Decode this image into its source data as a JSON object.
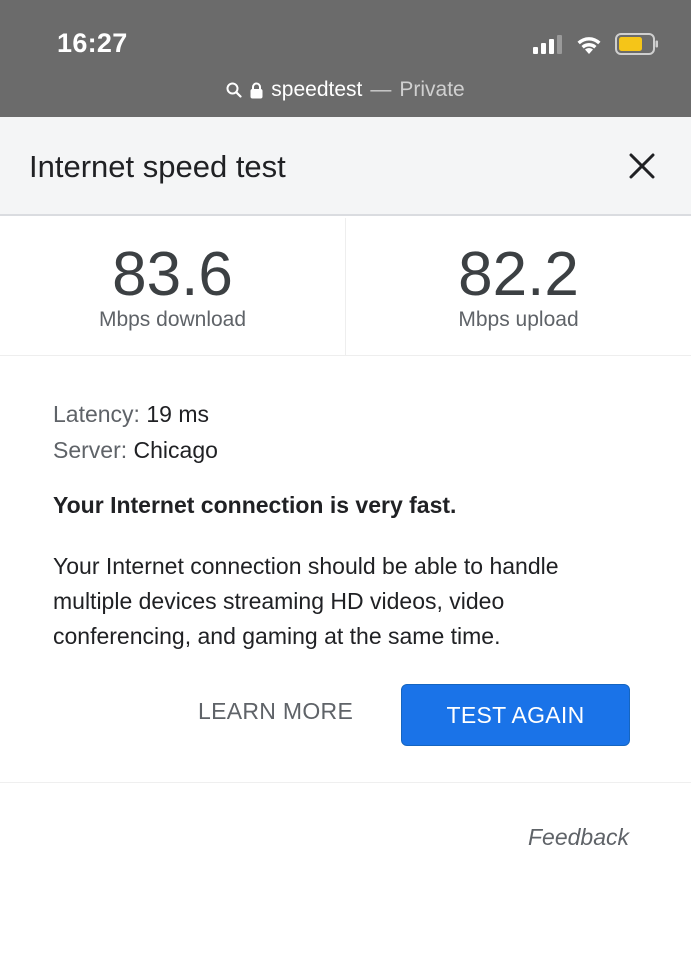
{
  "status_bar": {
    "time": "16:27",
    "battery_color": "#f5c518"
  },
  "url_bar": {
    "host": "speedtest",
    "separator": "—",
    "mode": "Private"
  },
  "header": {
    "title": "Internet speed test"
  },
  "results": {
    "download": {
      "value": "83.6",
      "unit": "Mbps download"
    },
    "upload": {
      "value": "82.2",
      "unit": "Mbps upload"
    }
  },
  "details": {
    "latency_label": "Latency:",
    "latency_value": "19 ms",
    "server_label": "Server:",
    "server_value": "Chicago"
  },
  "verdict": "Your Internet connection is very fast.",
  "description": "Your Internet connection should be able to handle multiple devices streaming HD videos, video conferencing, and gaming at the same time.",
  "actions": {
    "learn_more": "LEARN MORE",
    "test_again": "TEST AGAIN"
  },
  "feedback": "Feedback",
  "colors": {
    "accent": "#1a73e8",
    "header_bg": "#f4f5f6",
    "status_bg": "#6b6b6b"
  }
}
